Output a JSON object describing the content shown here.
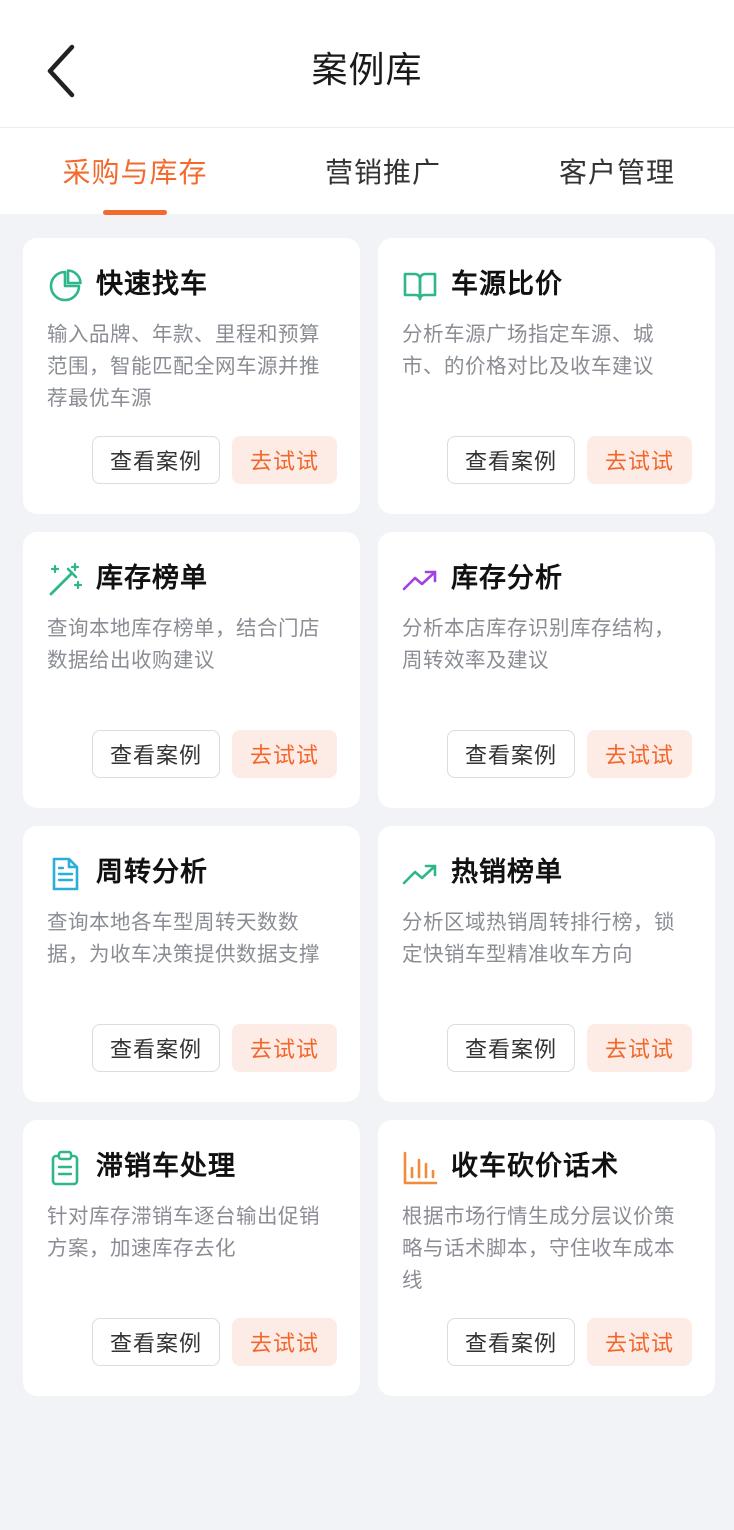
{
  "header": {
    "title": "案例库",
    "back_icon": "chevron-left-icon"
  },
  "tabs": [
    {
      "label": "采购与库存",
      "active": true
    },
    {
      "label": "营销推广",
      "active": false
    },
    {
      "label": "客户管理",
      "active": false
    }
  ],
  "accent_color": "#f26a2e",
  "cards": [
    {
      "icon": "pie-chart-icon",
      "icon_color": "#2fb68a",
      "title": "快速找车",
      "desc": "输入品牌、年款、里程和预算范围，智能匹配全网车源并推荐最优车源",
      "case_label": "查看案例",
      "try_label": "去试试"
    },
    {
      "icon": "open-book-icon",
      "icon_color": "#2fb68a",
      "title": "车源比价",
      "desc": "分析车源广场指定车源、城市、的价格对比及收车建议",
      "case_label": "查看案例",
      "try_label": "去试试"
    },
    {
      "icon": "magic-wand-icon",
      "icon_color": "#2fb68a",
      "title": "库存榜单",
      "desc": "查询本地库存榜单，结合门店数据给出收购建议",
      "case_label": "查看案例",
      "try_label": "去试试"
    },
    {
      "icon": "trending-up-icon",
      "icon_color": "#a142e0",
      "title": "库存分析",
      "desc": "分析本店库存识别库存结构，周转效率及建议",
      "case_label": "查看案例",
      "try_label": "去试试"
    },
    {
      "icon": "document-icon",
      "icon_color": "#2ab0d8",
      "title": "周转分析",
      "desc": "查询本地各车型周转天数数据，为收车决策提供数据支撑",
      "case_label": "查看案例",
      "try_label": "去试试"
    },
    {
      "icon": "trending-up-icon",
      "icon_color": "#2fb68a",
      "title": "热销榜单",
      "desc": "分析区域热销周转排行榜，锁定快销车型精准收车方向",
      "case_label": "查看案例",
      "try_label": "去试试"
    },
    {
      "icon": "clipboard-icon",
      "icon_color": "#2fb68a",
      "title": "滞销车处理",
      "desc": "针对库存滞销车逐台输出促销方案，加速库存去化",
      "case_label": "查看案例",
      "try_label": "去试试"
    },
    {
      "icon": "bar-chart-icon",
      "icon_color": "#f28a3c",
      "title": "收车砍价话术",
      "desc": "根据市场行情生成分层议价策略与话术脚本，守住收车成本线",
      "case_label": "查看案例",
      "try_label": "去试试"
    }
  ]
}
